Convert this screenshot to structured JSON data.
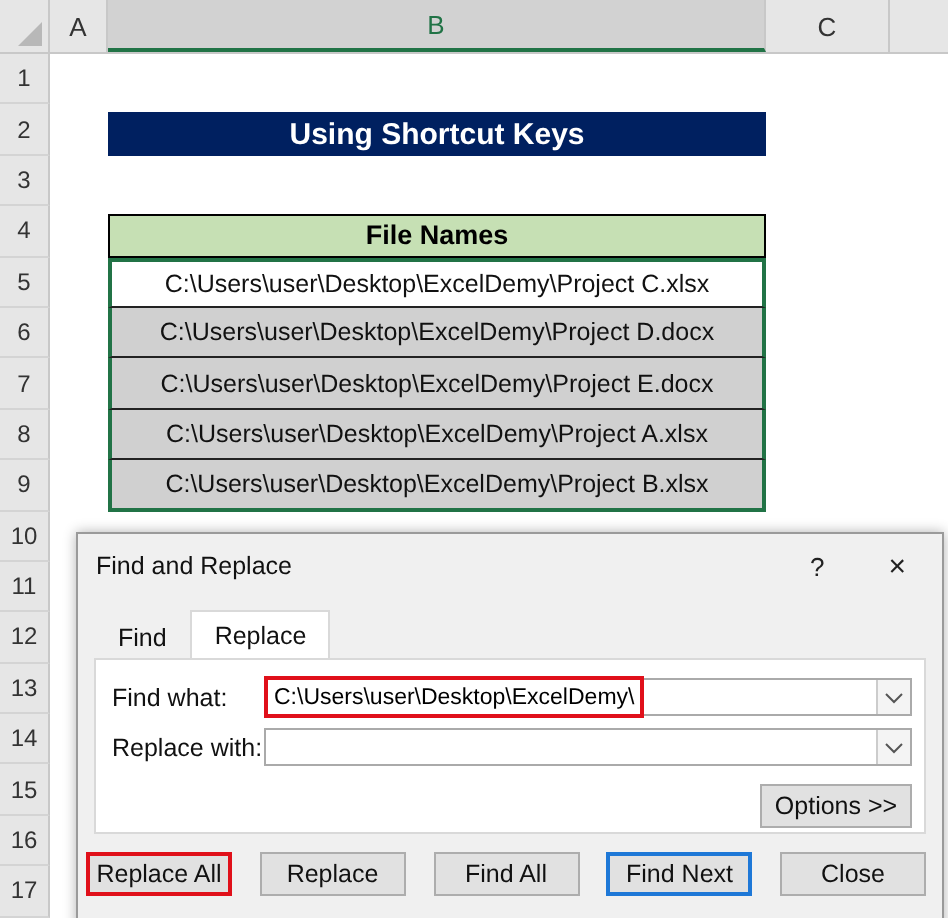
{
  "sheet": {
    "column_headers": [
      {
        "label": "A",
        "selected": false
      },
      {
        "label": "B",
        "selected": true
      },
      {
        "label": "C",
        "selected": false
      }
    ],
    "row_numbers": [
      "1",
      "2",
      "3",
      "4",
      "5",
      "6",
      "7",
      "8",
      "9",
      "10",
      "11",
      "12",
      "13",
      "14",
      "15",
      "16",
      "17"
    ],
    "title": "Using Shortcut Keys",
    "table": {
      "header": "File Names",
      "rows": [
        {
          "text": "C:\\Users\\user\\Desktop\\ExcelDemy\\Project C.xlsx",
          "shaded": false
        },
        {
          "text": "C:\\Users\\user\\Desktop\\ExcelDemy\\Project D.docx",
          "shaded": true
        },
        {
          "text": "C:\\Users\\user\\Desktop\\ExcelDemy\\Project E.docx",
          "shaded": true
        },
        {
          "text": "C:\\Users\\user\\Desktop\\ExcelDemy\\Project A.xlsx",
          "shaded": true
        },
        {
          "text": "C:\\Users\\user\\Desktop\\ExcelDemy\\Project B.xlsx",
          "shaded": true
        }
      ]
    }
  },
  "dialog": {
    "title": "Find and Replace",
    "help": "?",
    "close": "×",
    "tabs": [
      {
        "label": "Find",
        "selected": false
      },
      {
        "label": "Replace",
        "selected": true
      }
    ],
    "fields": [
      {
        "label": "Find what:",
        "value": "C:\\Users\\user\\Desktop\\ExcelDemy\\",
        "highlighted": true
      },
      {
        "label": "Replace with:",
        "highlighted": false
      }
    ],
    "options_button": "Options >>",
    "buttons": [
      {
        "label": "Replace All",
        "highlighted": true,
        "default": false
      },
      {
        "label": "Replace",
        "highlighted": false,
        "default": false
      },
      {
        "label": "Find All",
        "highlighted": false,
        "default": false
      },
      {
        "label": "Find Next",
        "highlighted": false,
        "default": true
      },
      {
        "label": "Close",
        "highlighted": false,
        "default": false
      }
    ]
  }
}
